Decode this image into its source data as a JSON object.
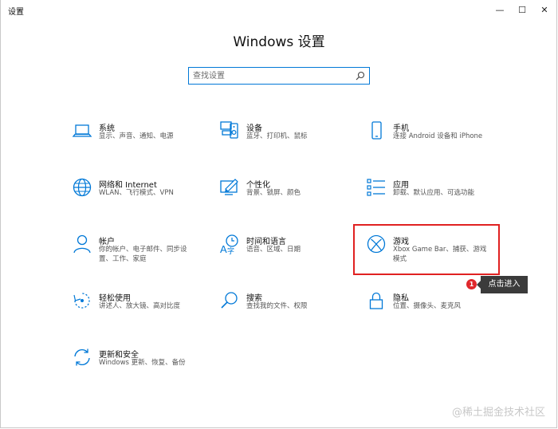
{
  "window": {
    "title": "设置",
    "minimize": "—",
    "maximize": "☐",
    "close": "✕"
  },
  "heading": "Windows 设置",
  "search": {
    "placeholder": "查找设置"
  },
  "tiles": [
    {
      "icon": "laptop-icon",
      "title": "系统",
      "desc": "显示、声音、通知、电源"
    },
    {
      "icon": "devices-icon",
      "title": "设备",
      "desc": "蓝牙、打印机、鼠标"
    },
    {
      "icon": "phone-icon",
      "title": "手机",
      "desc": "连接 Android 设备和 iPhone"
    },
    {
      "icon": "globe-icon",
      "title": "网络和 Internet",
      "desc": "WLAN、飞行模式、VPN"
    },
    {
      "icon": "personalization-icon",
      "title": "个性化",
      "desc": "背景、锁屏、颜色"
    },
    {
      "icon": "apps-icon",
      "title": "应用",
      "desc": "卸载、默认应用、可选功能"
    },
    {
      "icon": "person-icon",
      "title": "帐户",
      "desc": "你的帐户、电子邮件、同步设置、工作、家庭"
    },
    {
      "icon": "time-language-icon",
      "title": "时间和语言",
      "desc": "语音、区域、日期"
    },
    {
      "icon": "xbox-icon",
      "title": "游戏",
      "desc": "Xbox Game Bar、捕获、游戏模式"
    },
    {
      "icon": "ease-of-access-icon",
      "title": "轻松使用",
      "desc": "讲述人、放大镜、高对比度"
    },
    {
      "icon": "search-icon",
      "title": "搜索",
      "desc": "查找我的文件、权限"
    },
    {
      "icon": "lock-icon",
      "title": "隐私",
      "desc": "位置、摄像头、麦克风"
    },
    {
      "icon": "update-icon",
      "title": "更新和安全",
      "desc": "Windows 更新、恢复、备份"
    }
  ],
  "annotation": {
    "badge": "1",
    "tooltip": "点击进入"
  },
  "watermark": "@稀土掘金技术社区",
  "colors": {
    "accent": "#0078d7",
    "highlight": "#e02121"
  }
}
